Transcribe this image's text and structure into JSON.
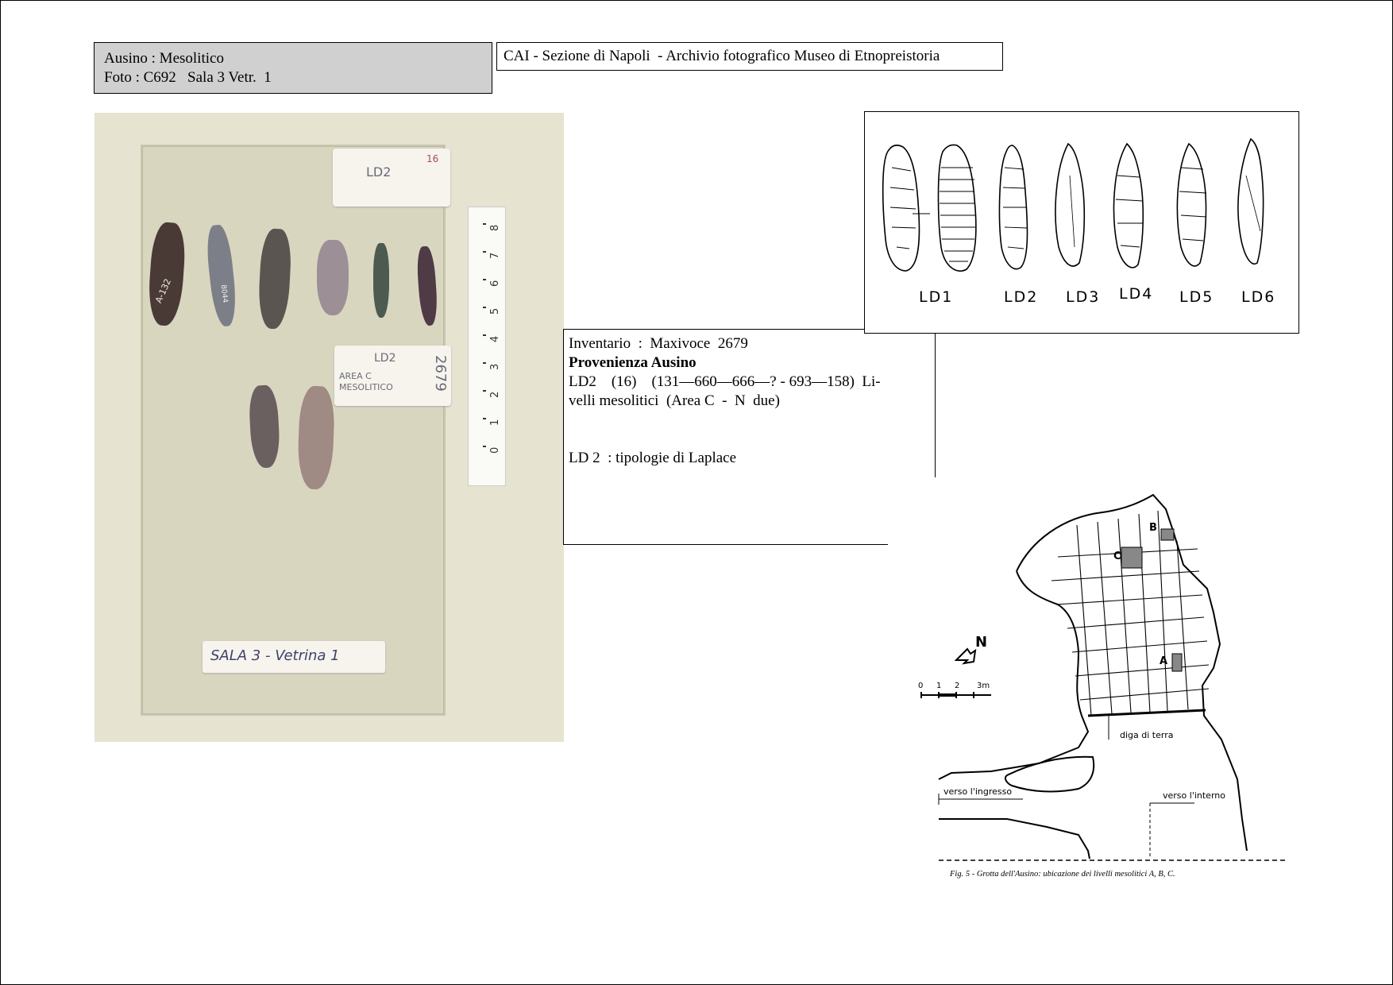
{
  "header": {
    "title_line1": "Ausino : Mesolitico",
    "title_line2": "Foto : C692   Sala 3 Vetr.  1",
    "archive": "CAI - Sezione di Napoli  - Archivio fotografico Museo di Etnopreistoria"
  },
  "info": {
    "line1": "Inventario  :  Maxivoce  2679",
    "line2": "Provenienza Ausino",
    "line3": "LD2    (16)    (131—660—666—? - 693—158)  Li-",
    "line4": "velli mesolitici  (Area C  -  N  due)",
    "line5": "LD 2  : tipologie di Laplace"
  },
  "photo": {
    "card_top": "LD2",
    "card_top_num": "16",
    "card_area_1": "LD2",
    "card_area_2": "AREA C",
    "card_area_3": "MESOLITICO",
    "card_area_4": "2679",
    "card_sala": "SALA 3  - Vetrina 1",
    "label_flint1": "A-132",
    "label_flint2": "8044",
    "ruler_labels": [
      "0",
      "1",
      "2",
      "3",
      "4",
      "5",
      "6",
      "7",
      "8"
    ]
  },
  "drawings": {
    "labels": [
      "LD1",
      "LD2",
      "LD3",
      "LD4",
      "LD5",
      "LD6"
    ]
  },
  "map": {
    "label_a": "A",
    "label_b": "B",
    "label_c": "C",
    "label_n": "N",
    "scale_labels": [
      "0",
      "1",
      "2",
      "3m"
    ],
    "diga": "diga di terra",
    "ingresso": "verso l'ingresso",
    "interno": "verso l'interno",
    "caption": "Fig. 5 - Grotta dell'Ausino: ubicazione dei livelli mesolitici A, B, C."
  }
}
